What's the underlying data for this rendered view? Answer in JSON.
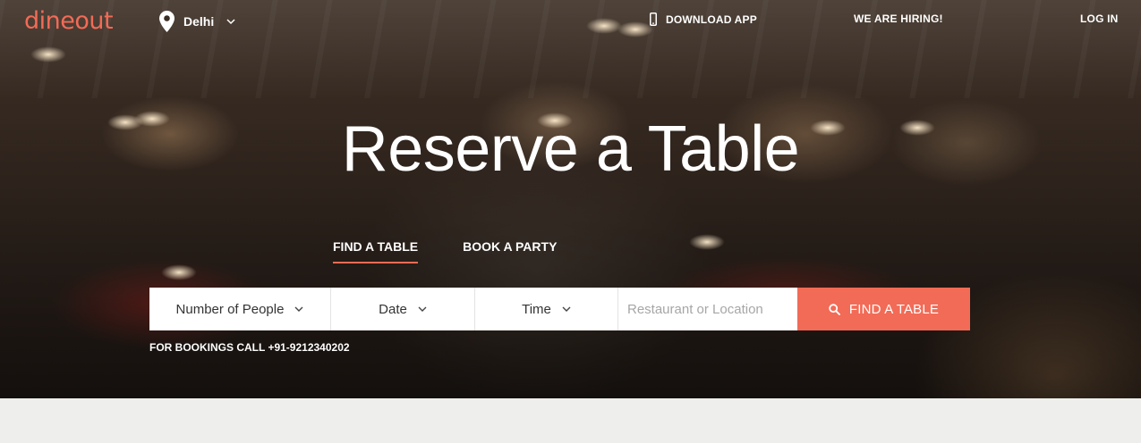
{
  "header": {
    "logo": "dineout",
    "city": "Delhi",
    "download_app": "DOWNLOAD APP",
    "hiring": "WE ARE HIRING!",
    "login": "LOG IN"
  },
  "hero": {
    "headline": "Reserve a Table",
    "tabs": [
      {
        "label": "FIND A TABLE",
        "active": true
      },
      {
        "label": "BOOK A PARTY",
        "active": false
      }
    ]
  },
  "search": {
    "people_label": "Number of People",
    "date_label": "Date",
    "time_label": "Time",
    "location_placeholder": "Restaurant or Location",
    "location_value": "",
    "submit_label": "FIND A TABLE"
  },
  "bookings_call": "FOR BOOKINGS CALL +91-9212340202",
  "icons": {
    "location": "map-pin-icon",
    "dropdown": "chevron-down-icon",
    "phone": "phone-icon",
    "search": "search-icon"
  },
  "colors": {
    "accent": "#f26b56",
    "page_bg": "#eeefec",
    "field_bg": "#ffffff",
    "placeholder": "#a6a6a6"
  }
}
